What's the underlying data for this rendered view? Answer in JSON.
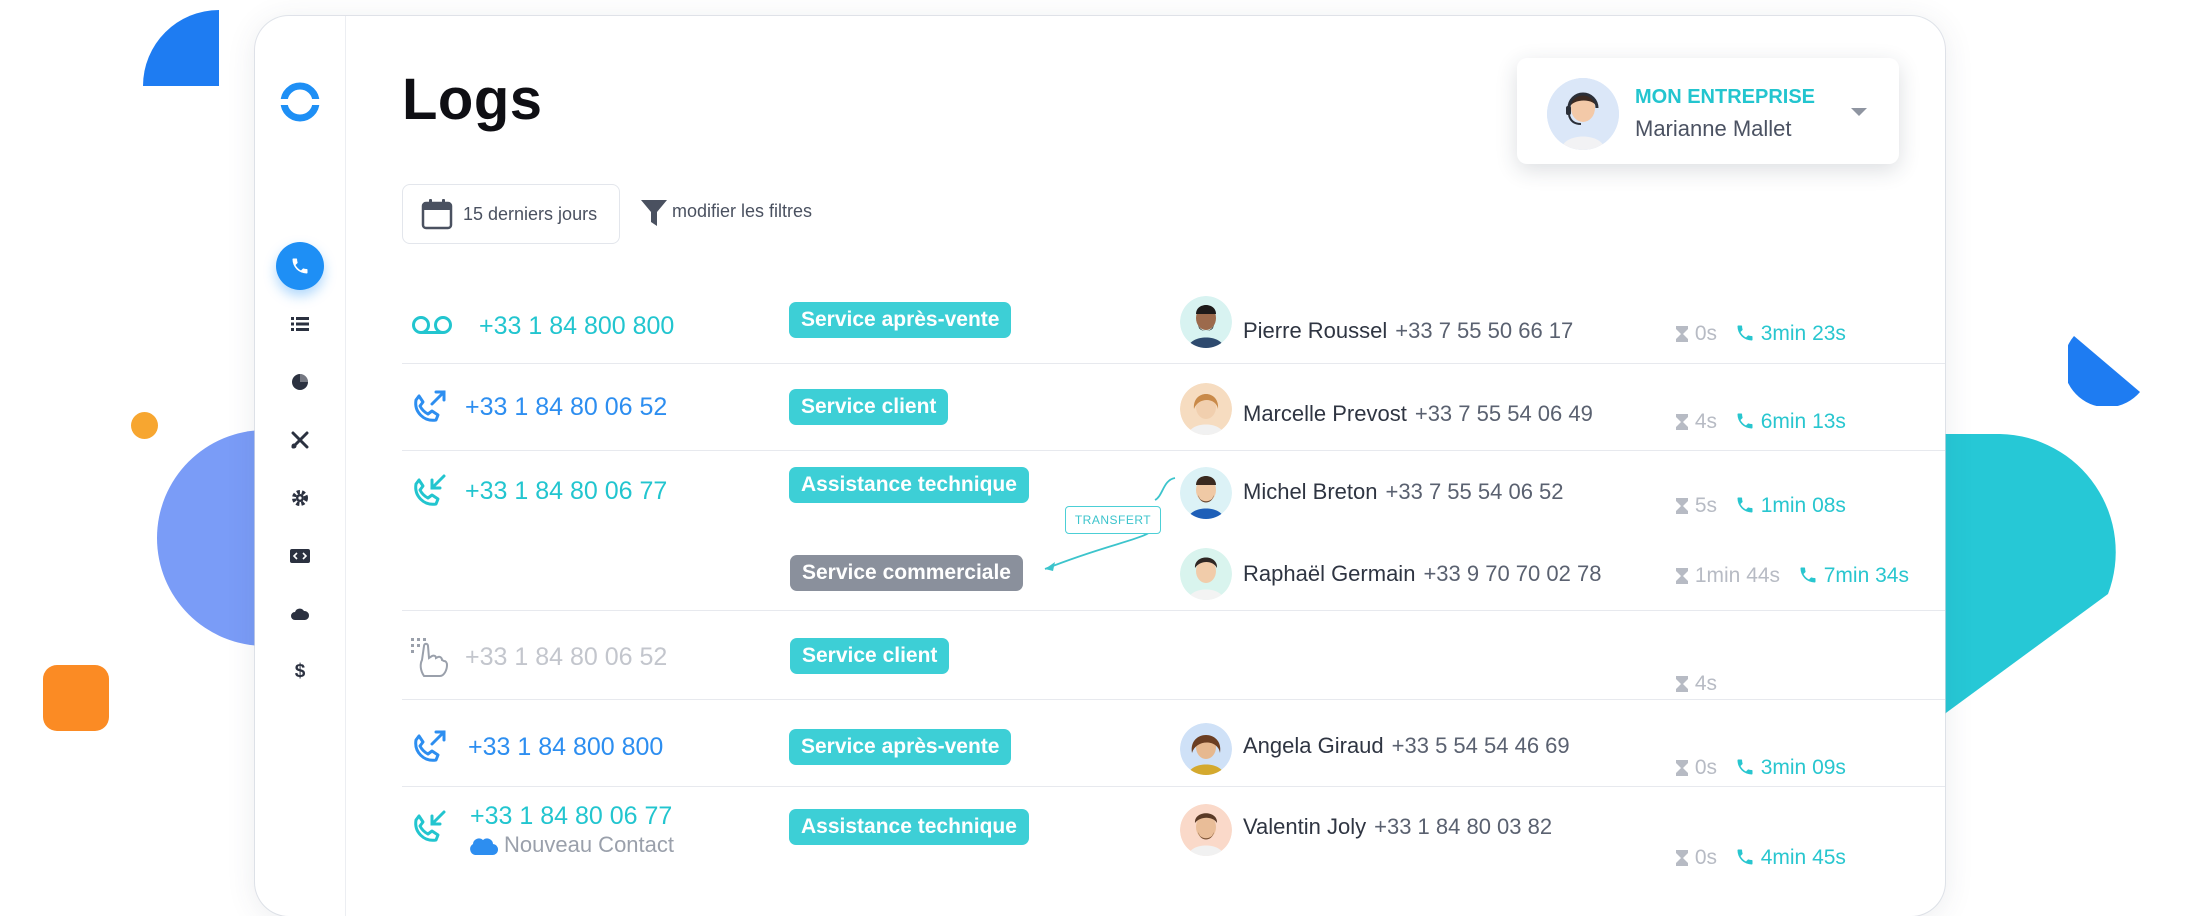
{
  "page": {
    "title": "Logs"
  },
  "colors": {
    "accent_blue": "#1e8ff5",
    "accent_teal": "#23c5cf",
    "tag_teal": "#3dcfd6",
    "tag_grey": "#8a909c"
  },
  "account": {
    "company": "MON ENTREPRISE",
    "user": "Marianne Mallet"
  },
  "filters": {
    "date_range": "15 derniers jours",
    "modify_label": "modifier les filtres"
  },
  "sidebar": {
    "items": [
      "phone-icon",
      "list-icon",
      "pie-chart-icon",
      "tools-icon",
      "settings-icon",
      "code-icon",
      "cloud-icon",
      "dollar-icon"
    ]
  },
  "logs": [
    {
      "type": "voicemail",
      "number": "+33 1 84 800 800",
      "service": "Service après-vente",
      "agent": "Pierre Roussel",
      "agent_phone": "+33 7 55 50 66 17",
      "wait": "0s",
      "talk": "3min 23s"
    },
    {
      "type": "outgoing",
      "number": "+33 1 84 80 06 52",
      "service": "Service client",
      "agent": "Marcelle Prevost",
      "agent_phone": "+33 7 55 54 06 49",
      "wait": "4s",
      "talk": "6min 13s"
    },
    {
      "type": "incoming",
      "number": "+33 1 84 80 06 77",
      "service": "Assistance technique",
      "agent": "Michel Breton",
      "agent_phone": "+33 7 55 54 06 52",
      "wait": "5s",
      "talk": "1min 08s",
      "transfer": {
        "label": "TRANSFERT",
        "service": "Service commerciale",
        "agent": "Raphaël Germain",
        "agent_phone": "+33 9 70 70 02 78",
        "wait": "1min 44s",
        "talk": "7min 34s"
      }
    },
    {
      "type": "ivr",
      "number": "+33 1 84 80 06 52",
      "service": "Service client",
      "wait": "4s"
    },
    {
      "type": "outgoing",
      "number": "+33 1 84 800 800",
      "service": "Service après-vente",
      "agent": "Angela Giraud",
      "agent_phone": "+33 5 54 54 46 69",
      "wait": "0s",
      "talk": "3min 09s"
    },
    {
      "type": "incoming",
      "number": "+33 1 84 80 06 77",
      "contact": "Nouveau Contact",
      "service": "Assistance technique",
      "agent": "Valentin Joly",
      "agent_phone": "+33 1 84 80 03 82",
      "wait": "0s",
      "talk": "4min 45s"
    }
  ]
}
